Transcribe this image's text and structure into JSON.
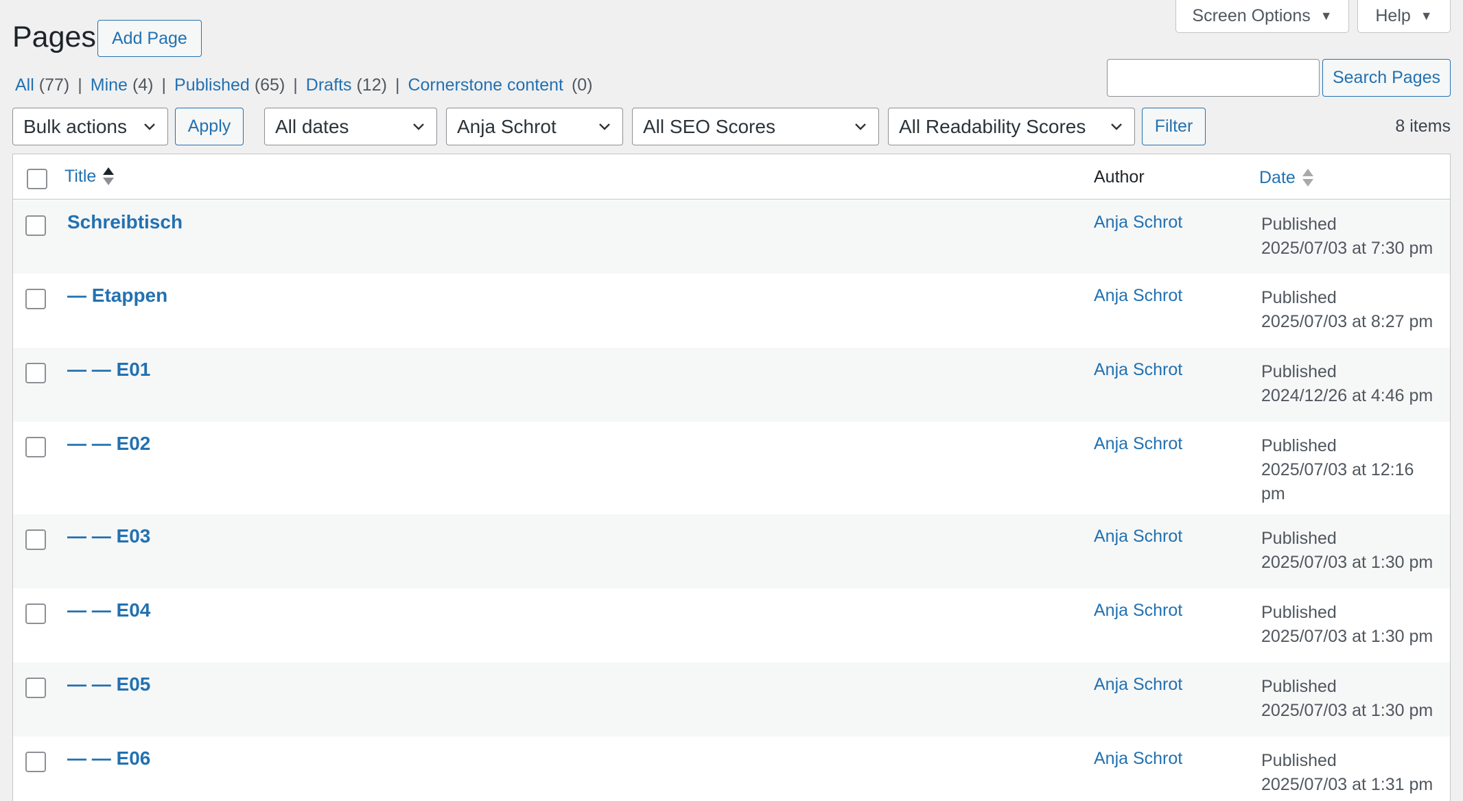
{
  "header": {
    "screen_options": "Screen Options",
    "help": "Help",
    "title": "Pages",
    "add_page": "Add Page"
  },
  "views": [
    {
      "label": "All",
      "count": "(77)"
    },
    {
      "label": "Mine",
      "count": "(4)"
    },
    {
      "label": "Published",
      "count": "(65)"
    },
    {
      "label": "Drafts",
      "count": "(12)"
    },
    {
      "label": "Cornerstone content",
      "count": "(0)"
    }
  ],
  "search": {
    "placeholder": "",
    "button": "Search Pages"
  },
  "filters": {
    "bulk_actions": "Bulk actions",
    "apply": "Apply",
    "dates": "All dates",
    "author": "Anja Schrot",
    "seo": "All SEO Scores",
    "readability": "All Readability Scores",
    "filter": "Filter",
    "items_count": "8 items"
  },
  "table": {
    "columns": {
      "title": "Title",
      "author": "Author",
      "date": "Date"
    },
    "rows": [
      {
        "title": "Schreibtisch",
        "author": "Anja Schrot",
        "status": "Published",
        "date": "2025/07/03 at 7:30 pm"
      },
      {
        "title": "— Etappen",
        "author": "Anja Schrot",
        "status": "Published",
        "date": "2025/07/03 at 8:27 pm"
      },
      {
        "title": "— — E01",
        "author": "Anja Schrot",
        "status": "Published",
        "date": "2024/12/26 at 4:46 pm"
      },
      {
        "title": "— — E02",
        "author": "Anja Schrot",
        "status": "Published",
        "date": "2025/07/03 at 12:16 pm"
      },
      {
        "title": "— — E03",
        "author": "Anja Schrot",
        "status": "Published",
        "date": "2025/07/03 at 1:30 pm"
      },
      {
        "title": "— — E04",
        "author": "Anja Schrot",
        "status": "Published",
        "date": "2025/07/03 at 1:30 pm"
      },
      {
        "title": "— — E05",
        "author": "Anja Schrot",
        "status": "Published",
        "date": "2025/07/03 at 1:30 pm"
      },
      {
        "title": "— — E06",
        "author": "Anja Schrot",
        "status": "Published",
        "date": "2025/07/03 at 1:31 pm"
      }
    ]
  }
}
